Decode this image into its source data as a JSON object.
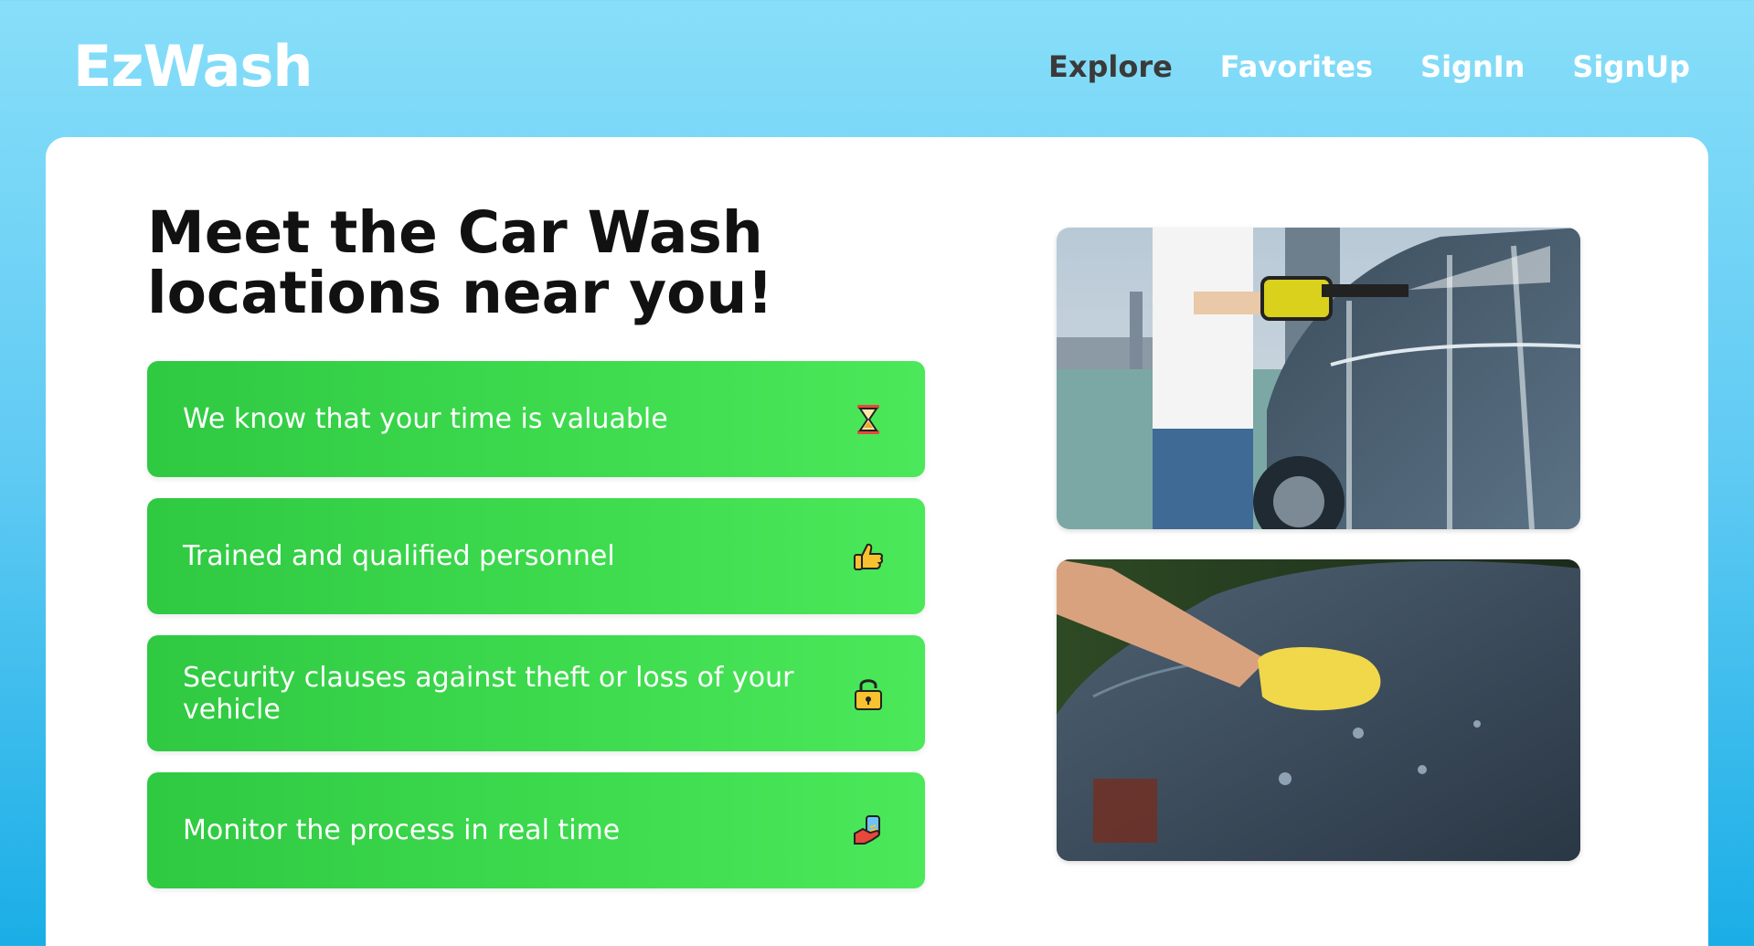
{
  "brand": {
    "logo": "EzWash"
  },
  "nav": {
    "items": [
      {
        "label": "Explore",
        "active": true
      },
      {
        "label": "Favorites",
        "active": false
      },
      {
        "label": "SignIn",
        "active": false
      },
      {
        "label": "SignUp",
        "active": false
      }
    ]
  },
  "hero": {
    "headline": "Meet the Car Wash locations near you!"
  },
  "features": [
    {
      "text": "We know that your time is valuable",
      "icon": "hourglass-icon"
    },
    {
      "text": "Trained and qualified personnel",
      "icon": "thumbs-up-icon"
    },
    {
      "text": "Security clauses against theft or loss of your vehicle",
      "icon": "padlock-icon"
    },
    {
      "text": "Monitor the process in real time",
      "icon": "hand-phone-icon"
    }
  ],
  "images": [
    {
      "subject": "pressure-washing-car"
    },
    {
      "subject": "sponge-cleaning-car"
    }
  ],
  "colors": {
    "background_top": "#87def9",
    "background_bottom": "#1aaee6",
    "feature_green": "#3fdc4f",
    "nav_active": "#3a3a3a"
  }
}
